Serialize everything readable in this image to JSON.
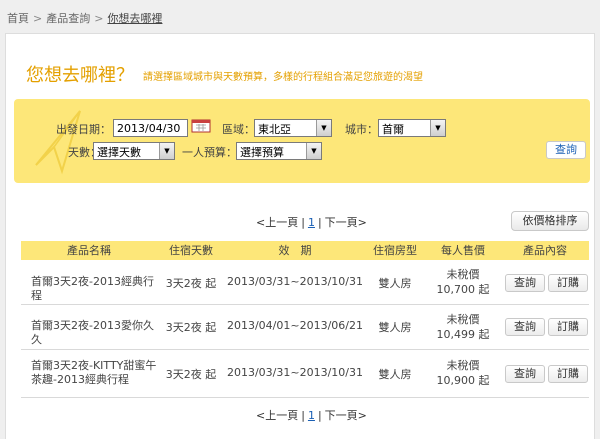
{
  "breadcrumb": {
    "items": [
      "首頁",
      "產品查詢",
      "你想去哪裡"
    ],
    "separator": ">"
  },
  "heading": {
    "title": "您想去哪裡？",
    "subtitle": "請選擇區域城市與天數預算，多樣的行程組合滿足您旅遊的渴望"
  },
  "search": {
    "depart_label": "出發日期：",
    "depart_value": "2013/04/30",
    "region_label": "區域：",
    "region_value": "東北亞",
    "city_label": "城市：",
    "city_value": "首爾",
    "days_label": "天數：",
    "days_value": "選擇天數",
    "budget_label": "一人預算：",
    "budget_value": "選擇預算",
    "query_label": "查詢"
  },
  "pager": {
    "prev": "<上一頁",
    "current": "1",
    "next": "下一頁>",
    "bar": "|"
  },
  "sort_label": "依價格排序",
  "table": {
    "headers": [
      "產品名稱",
      "住宿天數",
      "效　期",
      "住宿房型",
      "每人售價",
      "產品內容"
    ],
    "rows": [
      {
        "name": "首爾3天2夜-2013經典行程",
        "stay": "3天2夜 起",
        "period": "2013/03/31~2013/10/31",
        "room": "雙人房",
        "price_label": "未稅價",
        "price": "10,700 起",
        "btn_query": "查詢",
        "btn_order": "訂購"
      },
      {
        "name": "首爾3天2夜-2013愛你久久",
        "stay": "3天2夜 起",
        "period": "2013/04/01~2013/06/21",
        "room": "雙人房",
        "price_label": "未稅價",
        "price": "10,499 起",
        "btn_query": "查詢",
        "btn_order": "訂購"
      },
      {
        "name": "首爾3天2夜-KITTY甜蜜午茶趣-2013經典行程",
        "stay": "3天2夜 起",
        "period": "2013/03/31~2013/10/31",
        "room": "雙人房",
        "price_label": "未稅價",
        "price": "10,900 起",
        "btn_query": "查詢",
        "btn_order": "訂購"
      }
    ]
  },
  "colors": {
    "accent": "#e4a000",
    "search_bg": "#fde779",
    "link": "#1a5fb4"
  }
}
